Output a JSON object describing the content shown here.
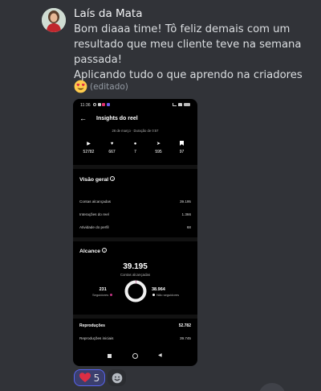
{
  "message": {
    "username": "Laís da Mata",
    "text_lines": [
      "Bom diaaa time! Tô feliz demais com um",
      "resultado que meu cliente teve na semana",
      "passada!",
      "Aplicando tudo o que aprendo na criadores"
    ],
    "emoji": "heart-eyes-emoji",
    "edited_label": "(editado)"
  },
  "screenshot": {
    "status_time": "11:36",
    "title": "Insights do reel",
    "subtitle": "26 de março · Duração de 0:57",
    "stats": [
      {
        "icon": "play-icon",
        "value": "52782"
      },
      {
        "icon": "heart-icon",
        "value": "667"
      },
      {
        "icon": "comment-icon",
        "value": "7"
      },
      {
        "icon": "send-icon",
        "value": "595"
      },
      {
        "icon": "bookmark-icon",
        "value": "97"
      }
    ],
    "overview": {
      "title": "Visão geral",
      "rows": [
        {
          "label": "Contas alcançadas",
          "value": "39.195"
        },
        {
          "label": "Interações do reel",
          "value": "1.366"
        },
        {
          "label": "Atividade do perfil",
          "value": "68"
        }
      ]
    },
    "reach": {
      "title": "Alcance",
      "total": "39.195",
      "total_label": "Contas alcançadas",
      "followers_value": "231",
      "followers_label": "Seguidores",
      "non_followers_value": "38.964",
      "non_followers_label": "Não seguidores",
      "followers_fraction": 0.006,
      "colors": {
        "followers": "#c13584",
        "non_followers": "#f1f1f1"
      }
    },
    "plays": {
      "rows": [
        {
          "label": "Reproduções",
          "value": "52.782"
        },
        {
          "label": "Reproduções iniciais",
          "value": "39.745"
        }
      ]
    }
  },
  "reactions": [
    {
      "emoji": "heart-emoji",
      "count": "5",
      "color": "#dd2e44"
    }
  ],
  "colors": {
    "background": "#313338",
    "accent": "#5865f2"
  }
}
